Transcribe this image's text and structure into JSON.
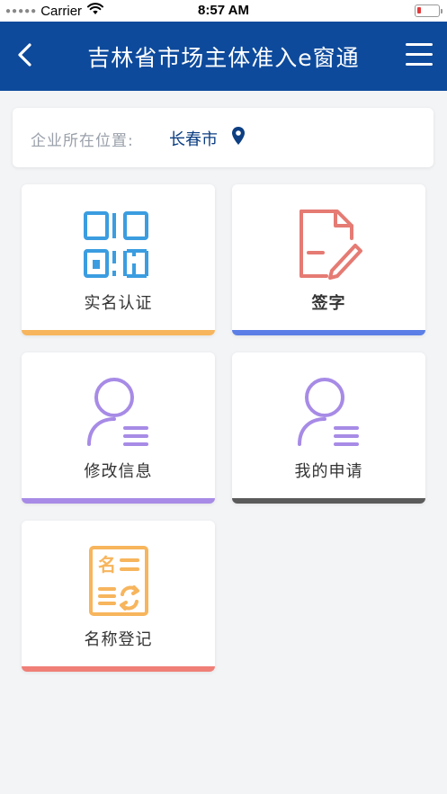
{
  "status_bar": {
    "carrier": "Carrier",
    "time": "8:57 AM"
  },
  "nav": {
    "title": "吉林省市场主体准入e窗通",
    "back_icon": "chevron-left-icon",
    "menu_icon": "hamburger-menu-icon"
  },
  "location": {
    "label": "企业所在位置:",
    "value": "长春市",
    "icon": "map-pin-icon"
  },
  "tiles": [
    {
      "label": "实名认证",
      "icon": "qr-code-icon",
      "bar_color": "#f7b55d",
      "icon_color": "#3b9de0"
    },
    {
      "label": "签字",
      "icon": "document-pen-icon",
      "bar_color": "#5b7fe6",
      "icon_color": "#e57b73"
    },
    {
      "label": "修改信息",
      "icon": "user-edit-icon",
      "bar_color": "#a78be6",
      "icon_color": "#a78be6"
    },
    {
      "label": "我的申请",
      "icon": "user-list-icon",
      "bar_color": "#5b5b5b",
      "icon_color": "#a78be6"
    },
    {
      "label": "名称登记",
      "icon": "name-register-icon",
      "bar_color": "#ef7f77",
      "icon_color": "#f7b55d"
    }
  ],
  "colors": {
    "nav_background": "#0d4a9c",
    "location_value": "#0d3f82",
    "page_background": "#f3f4f6"
  }
}
